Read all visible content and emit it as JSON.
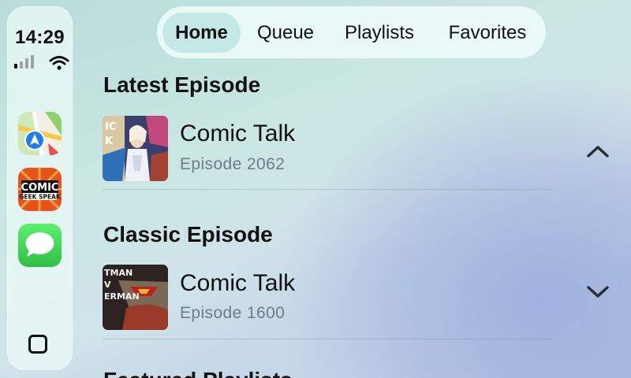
{
  "status_bar": {
    "time": "14:29"
  },
  "dock": {
    "apps": [
      {
        "name": "Maps",
        "icon": "maps-icon"
      },
      {
        "name": "Comic Geek Speak",
        "icon": "podcast-app-icon",
        "logo_text_1": "COMIC",
        "logo_text_2": "GEEK SPEAK"
      },
      {
        "name": "Messages",
        "icon": "messages-icon"
      }
    ]
  },
  "tabs": [
    {
      "label": "Home",
      "active": true
    },
    {
      "label": "Queue",
      "active": false
    },
    {
      "label": "Playlists",
      "active": false
    },
    {
      "label": "Favorites",
      "active": false
    }
  ],
  "sections": [
    {
      "title": "Latest Episode",
      "episode": {
        "title": "Comic Talk",
        "subtitle": "Episode 2062",
        "chevron": "chevron-up-icon"
      }
    },
    {
      "title": "Classic Episode",
      "episode": {
        "title": "Comic Talk",
        "subtitle": "Episode 1600",
        "chevron": "chevron-down-icon"
      }
    },
    {
      "title": "Featured Playlists"
    }
  ],
  "colors": {
    "accent_tab": "#b4e1de",
    "maps_green": "#34c759",
    "messages_green": "#34c759",
    "podcast_orange": "#e8521b"
  }
}
